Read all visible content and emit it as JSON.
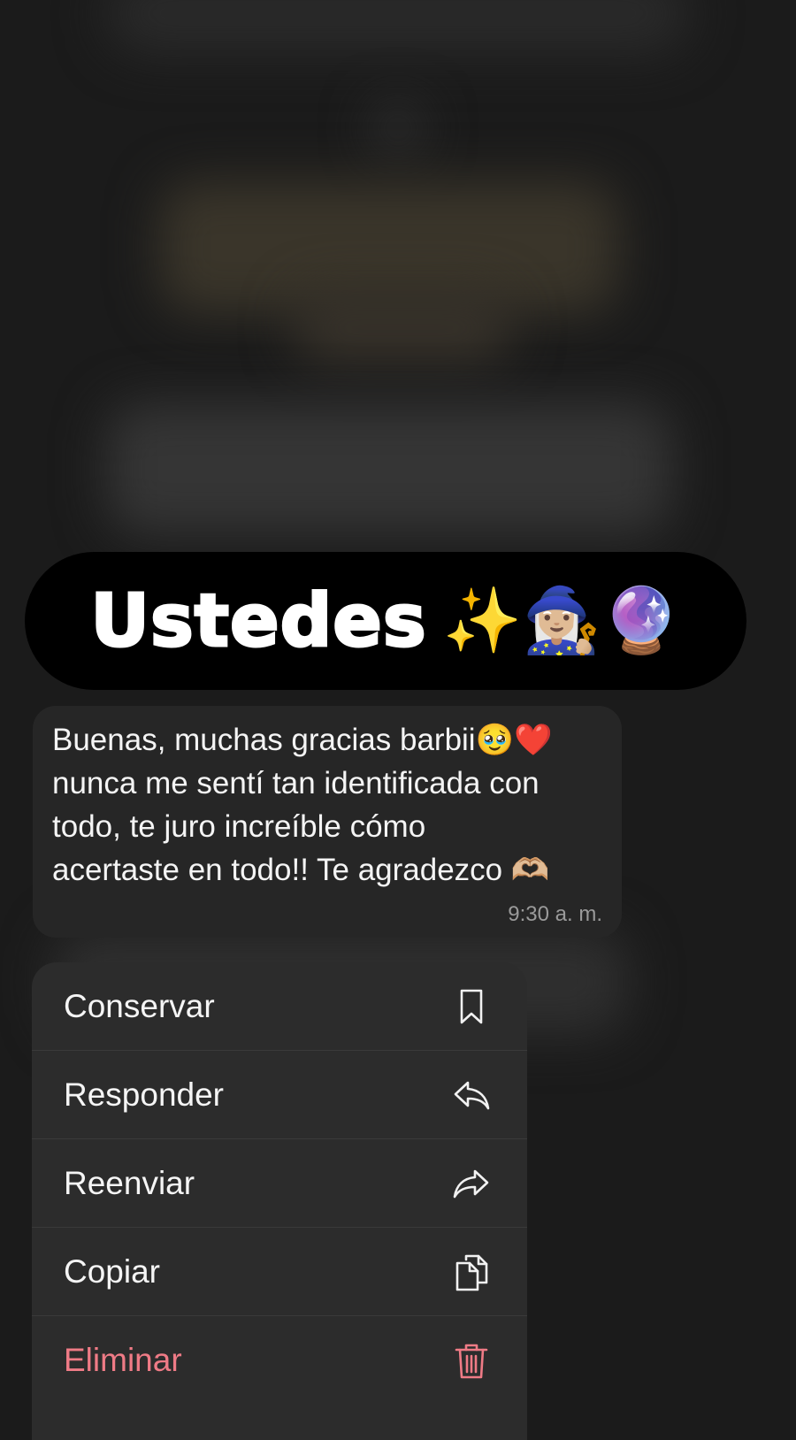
{
  "header": {
    "title": "Ustedes",
    "emojis": "✨🧙🏼‍♀️🔮"
  },
  "message": {
    "text": "Buenas, muchas gracias barbii🥹❤️\nnunca me sentí tan identificada con\ntodo, te juro increíble cómo\nacertaste en todo!! Te agradezco 🫶🏼",
    "time": "9:30 a. m."
  },
  "menu": {
    "items": [
      {
        "label": "Conservar",
        "icon": "bookmark-icon"
      },
      {
        "label": "Responder",
        "icon": "reply-icon"
      },
      {
        "label": "Reenviar",
        "icon": "forward-icon"
      },
      {
        "label": "Copiar",
        "icon": "copy-icon"
      },
      {
        "label": "Eliminar",
        "icon": "trash-icon"
      }
    ],
    "danger_color": "#ef7b86"
  }
}
